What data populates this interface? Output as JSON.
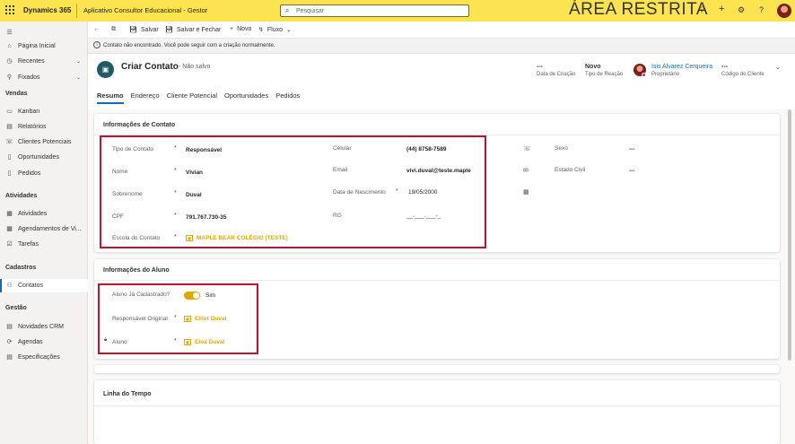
{
  "topbar": {
    "app_name": "Dynamics 365",
    "app_title": "Aplicativo Consultor Educacional - Gestor",
    "search_placeholder": "Pesquisar",
    "restricted_label": "ÁREA RESTRITA",
    "icons": [
      "lightbulb-icon",
      "plus-icon",
      "gear-icon",
      "help-icon",
      "user-avatar"
    ]
  },
  "sidebar": {
    "top_items": [
      {
        "label": "Página Inicial",
        "icon": "home-icon"
      },
      {
        "label": "Recentes",
        "icon": "clock-icon"
      },
      {
        "label": "Fixados",
        "icon": "pin-icon"
      }
    ],
    "sections": [
      {
        "title": "Vendas",
        "items": [
          "Kanban",
          "Relatórios",
          "Clientes Potenciais",
          "Oportunidades",
          "Pedidos"
        ]
      },
      {
        "title": "Atividades",
        "items": [
          "Atividades",
          "Agendamentos de Vi...",
          "Tarefas"
        ]
      },
      {
        "title": "Cadastros",
        "items": [
          "Contatos"
        ]
      },
      {
        "title": "Gestão",
        "items": [
          "Novidades CRM",
          "Agendas",
          "Especificações"
        ]
      }
    ],
    "active_item": "Contatos"
  },
  "commandbar": {
    "save": "Salvar",
    "save_close": "Salvar e Fechar",
    "new": "Novo",
    "flow": "Fluxo"
  },
  "notification": "Contato não encontrado. Você pode seguir com a criação normalmente.",
  "header": {
    "title": "Criar Contato",
    "status": "- Não salvo",
    "fields": [
      {
        "value": "---",
        "label": "Data de Criação"
      },
      {
        "value": "Novo",
        "label": "Tipo de Reação"
      },
      {
        "value": "Isis Alvarez Cerqueira",
        "label": "Proprietário"
      },
      {
        "value": "---",
        "label": "Código do Cliente"
      }
    ],
    "tabs": [
      "Resumo",
      "Endereço",
      "Cliente Potencial",
      "Oportunidades",
      "Pedidos"
    ],
    "active_tab": "Resumo"
  },
  "contact_section": {
    "title": "Informações de Contato",
    "left": [
      {
        "label": "Tipo de Contato",
        "value": "Responsável"
      },
      {
        "label": "Nome",
        "value": "Vivian"
      },
      {
        "label": "Sobrenome",
        "value": "Duval"
      },
      {
        "label": "CPF",
        "value": "791.767.730-35"
      },
      {
        "label": "Escola do Contato",
        "value": "MAPLE BEAR COLÉGIO (TESTE)"
      }
    ],
    "middle": [
      {
        "label": "Celular",
        "value": "(44) 8758-7589"
      },
      {
        "label": "Email",
        "value": "vivi.duval@teste.maple"
      },
      {
        "label": "Data de Nascimento",
        "value": "19/05/2000"
      },
      {
        "label": "RG",
        "value": "__.___.___-_"
      }
    ],
    "right": [
      {
        "label": "Sexo",
        "value": "---"
      },
      {
        "label": "Estado Civil",
        "value": "---"
      }
    ]
  },
  "student_section": {
    "title": "Informações do Aluno",
    "registered_label": "Aluno Já Cadastrado?",
    "registered_value": "Sim",
    "guardian_label": "Responsável Original",
    "guardian_value": "Elliot Duval",
    "student_label": "Aluno",
    "student_value": "Eloá Duval"
  },
  "timeline_section": {
    "title": "Linha do Tempo"
  },
  "colors": {
    "topbar": "#fbe44f",
    "accent": "#0f6cbd",
    "lookup": "#e0a800",
    "highlight_box": "#c8102e",
    "required": "#a4262c"
  }
}
